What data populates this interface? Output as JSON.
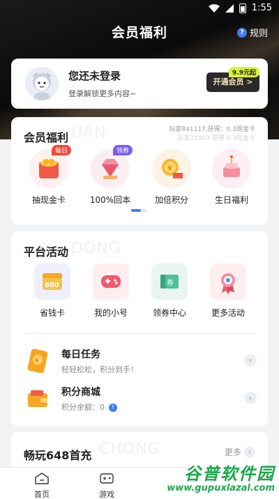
{
  "status": {
    "time": "1:55"
  },
  "header": {
    "title": "会员福利",
    "rules_label": "规则"
  },
  "login": {
    "title": "您还未登录",
    "subtitle": "登录解锁更多内容~",
    "vip_button": "开通会员 >",
    "vip_price_tag": "9.9元起"
  },
  "benefits": {
    "title": "会员福利",
    "watermark": "UAN",
    "ticker": [
      "玩家841117,获得：0.3现金卡",
      "玩家31003 获得 0.3现金卡"
    ],
    "items": [
      {
        "label": "抽现金卡",
        "tag": "每日"
      },
      {
        "label": "100%回本",
        "tag": "领券"
      },
      {
        "label": "加倍积分",
        "tag": ""
      },
      {
        "label": "生日福利",
        "tag": ""
      }
    ]
  },
  "activities": {
    "title": "平台活动",
    "watermark": "DONG",
    "items": [
      {
        "label": "省钱卡",
        "icon_text": "600"
      },
      {
        "label": "我的小号",
        "icon_text": ""
      },
      {
        "label": "领券中心",
        "icon_text": "券"
      },
      {
        "label": "更多活动",
        "icon_text": ""
      }
    ],
    "tasks": [
      {
        "title": "每日任务",
        "subtitle": "轻轻松松，积分到手！"
      },
      {
        "title": "积分商城",
        "subtitle": "积分余额：0"
      }
    ]
  },
  "promo": {
    "title": "畅玩648首充",
    "watermark": "CHONG",
    "more_label": "更多"
  },
  "tabbar": {
    "items": [
      "首页",
      "游戏"
    ]
  },
  "site_watermark": {
    "brand": "谷普软件园",
    "url": "www.gupuxlazal.com"
  },
  "colors": {
    "accent": "#3f7ee8",
    "vip_bg": "#2a2a2a",
    "vip_text": "#f6e3b6",
    "brand_green": "#1ba84a"
  }
}
